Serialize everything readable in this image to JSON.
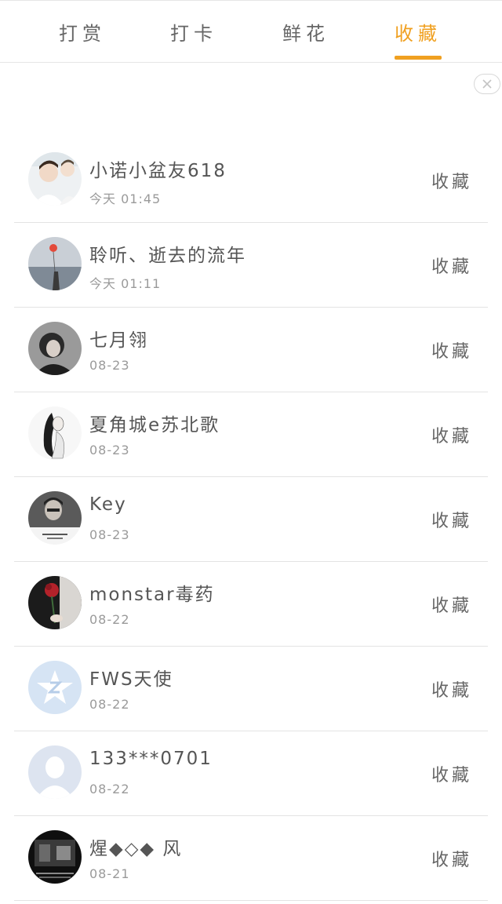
{
  "tabs": [
    {
      "label": "打赏",
      "active": false
    },
    {
      "label": "打卡",
      "active": false
    },
    {
      "label": "鲜花",
      "active": false
    },
    {
      "label": "收藏",
      "active": true
    }
  ],
  "accent_color": "#f0a020",
  "close_icon": "close-icon",
  "items": [
    {
      "name": "小诺小盆友618",
      "time": "今天 01:45",
      "action": "收藏",
      "avatar": "photo-two-boys"
    },
    {
      "name": "聆听、逝去的流年",
      "time": "今天 01:11",
      "action": "收藏",
      "avatar": "photo-girl-sea-balloon"
    },
    {
      "name": "七月翎",
      "time": "08-23",
      "action": "收藏",
      "avatar": "photo-dark-portrait"
    },
    {
      "name": "夏角城e苏北歌",
      "time": "08-23",
      "action": "收藏",
      "avatar": "ink-drawing-woman"
    },
    {
      "name": "Key",
      "time": "08-23",
      "action": "收藏",
      "avatar": "photo-man-bw"
    },
    {
      "name": "monstar毒药",
      "time": "08-22",
      "action": "收藏",
      "avatar": "photo-red-rose"
    },
    {
      "name": "FWS天使",
      "time": "08-22",
      "action": "收藏",
      "avatar": "qq-star-default"
    },
    {
      "name": "133***0701",
      "time": "08-22",
      "action": "收藏",
      "avatar": "default-person"
    },
    {
      "name": "煋◆◇◆ 风",
      "time": "08-21",
      "action": "收藏",
      "avatar": "photo-dark-room"
    }
  ]
}
